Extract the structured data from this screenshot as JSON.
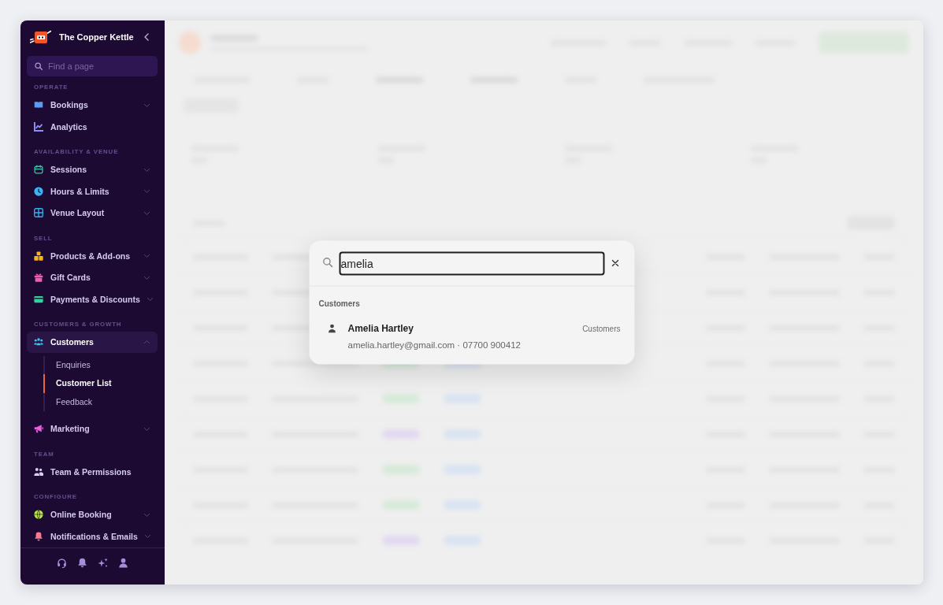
{
  "sidebar": {
    "brand": "The Copper Kettle",
    "search": {
      "placeholder": "Find a page"
    },
    "sections": [
      {
        "label": "OPERATE",
        "items": [
          {
            "label": "Bookings",
            "color": "#5a9cf2",
            "expanded": false,
            "selected": false
          },
          {
            "label": "Analytics",
            "color": "#8e8ff2",
            "selected": false
          }
        ]
      },
      {
        "label": "AVAILABILITY & VENUE",
        "items": [
          {
            "label": "Sessions",
            "color": "#2fcaa6",
            "expanded": false,
            "selected": false
          },
          {
            "label": "Hours & Limits",
            "color": "#38b6f4",
            "expanded": false,
            "selected": false
          },
          {
            "label": "Venue Layout",
            "color": "#36aef0",
            "expanded": false,
            "selected": false
          }
        ]
      },
      {
        "label": "SELL",
        "items": [
          {
            "label": "Products & Add-ons",
            "color": "#f4b41e",
            "expanded": false,
            "selected": false
          },
          {
            "label": "Gift Cards",
            "color": "#f25fb2",
            "expanded": false,
            "selected": false
          },
          {
            "label": "Payments & Discounts",
            "color": "#2fd49a",
            "expanded": false,
            "selected": false
          }
        ]
      },
      {
        "label": "CUSTOMERS & GROWTH",
        "items": [
          {
            "label": "Customers",
            "color": "#3ac6f2",
            "expanded": true,
            "selected": true,
            "children": [
              {
                "label": "Enquiries",
                "selected": false
              },
              {
                "label": "Customer List",
                "selected": true
              },
              {
                "label": "Feedback",
                "selected": false
              }
            ]
          },
          {
            "label": "Marketing",
            "color": "#e462dc",
            "expanded": false,
            "selected": false
          }
        ]
      },
      {
        "label": "TEAM",
        "items": [
          {
            "label": "Team & Permissions",
            "color": "#d8cef0",
            "selected": false
          }
        ]
      },
      {
        "label": "CONFIGURE",
        "items": [
          {
            "label": "Online Booking",
            "color": "#b6ea3c",
            "expanded": false,
            "selected": false
          },
          {
            "label": "Notifications & Emails",
            "color": "#f87a90",
            "expanded": false,
            "selected": false
          }
        ]
      }
    ]
  },
  "search_dialog": {
    "query": "amelia",
    "groups": [
      {
        "label": "Customers",
        "results": [
          {
            "name": "Amelia Hartley",
            "detail": "amelia.hartley@gmail.com · 07700 900412",
            "category": "Customers"
          }
        ]
      }
    ]
  }
}
